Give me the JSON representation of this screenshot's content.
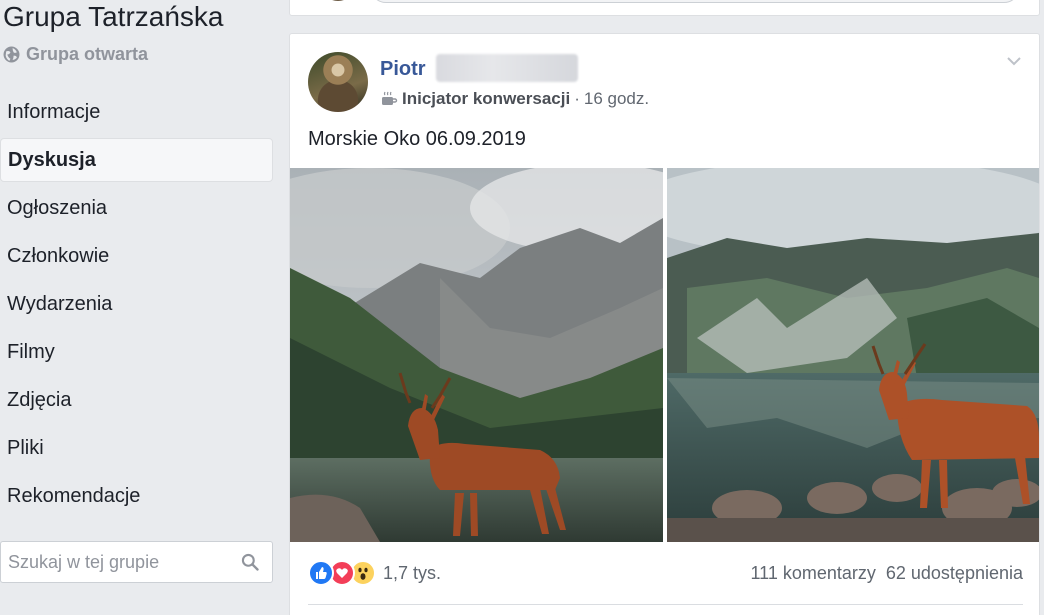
{
  "group": {
    "title": "Grupa Tatrzańska",
    "privacy": "Grupa otwarta"
  },
  "nav": {
    "items": [
      {
        "label": "Informacje"
      },
      {
        "label": "Dyskusja",
        "active": true
      },
      {
        "label": "Ogłoszenia"
      },
      {
        "label": "Członkowie"
      },
      {
        "label": "Wydarzenia"
      },
      {
        "label": "Filmy"
      },
      {
        "label": "Zdjęcia"
      },
      {
        "label": "Pliki"
      },
      {
        "label": "Rekomendacje"
      }
    ]
  },
  "search": {
    "placeholder": "Szukaj w tej grupie"
  },
  "post": {
    "author": "Piotr",
    "badge": "Inicjator konwersacji",
    "separator": "·",
    "time": "16 godz.",
    "text": "Morskie Oko 06.09.2019",
    "reactions": {
      "types": [
        "like-icon",
        "love-icon",
        "wow-icon"
      ],
      "count": "1,7 tys."
    },
    "comments": "111 komentarzy",
    "shares": "62 udostępnienia"
  },
  "colors": {
    "link": "#385898",
    "background": "#e9ebee",
    "like": "#2078f4",
    "love": "#f33e58",
    "wow": "#fcd25e"
  }
}
